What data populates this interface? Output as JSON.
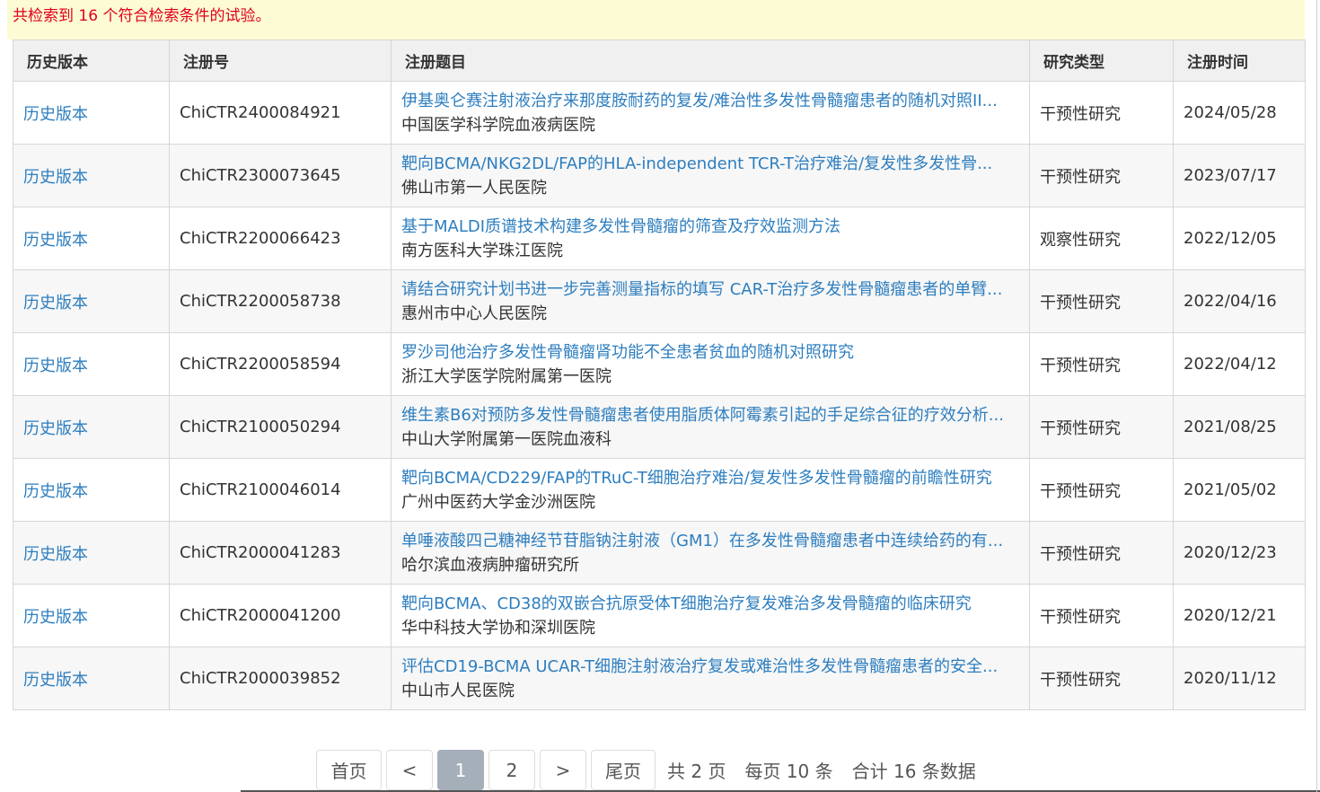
{
  "notice": {
    "text": "共检索到 16 个符合检索条件的试验。"
  },
  "results": {
    "columns": {
      "history": "历史版本",
      "reg_no": "注册号",
      "title": "注册题目",
      "study_type": "研究类型",
      "date": "注册时间"
    },
    "rows": [
      {
        "history": "历史版本",
        "reg_no": "ChiCTR2400084921",
        "title": "伊基奥仑赛注射液治疗来那度胺耐药的复发/难治性多发性骨髓瘤患者的随机对照II...",
        "institution": "中国医学科学院血液病医院",
        "study_type": "干预性研究",
        "date": "2024/05/28"
      },
      {
        "history": "历史版本",
        "reg_no": "ChiCTR2300073645",
        "title": "靶向BCMA/NKG2DL/FAP的HLA-independent TCR-T治疗难治/复发性多发性骨...",
        "institution": "佛山市第一人民医院",
        "study_type": "干预性研究",
        "date": "2023/07/17"
      },
      {
        "history": "历史版本",
        "reg_no": "ChiCTR2200066423",
        "title": "基于MALDI质谱技术构建多发性骨髓瘤的筛查及疗效监测方法",
        "institution": "南方医科大学珠江医院",
        "study_type": "观察性研究",
        "date": "2022/12/05"
      },
      {
        "history": "历史版本",
        "reg_no": "ChiCTR2200058738",
        "title": "请结合研究计划书进一步完善测量指标的填写 CAR-T治疗多发性骨髓瘤患者的单臂...",
        "institution": "惠州市中心人民医院",
        "study_type": "干预性研究",
        "date": "2022/04/16"
      },
      {
        "history": "历史版本",
        "reg_no": "ChiCTR2200058594",
        "title": "罗沙司他治疗多发性骨髓瘤肾功能不全患者贫血的随机对照研究",
        "institution": "浙江大学医学院附属第一医院",
        "study_type": "干预性研究",
        "date": "2022/04/12"
      },
      {
        "history": "历史版本",
        "reg_no": "ChiCTR2100050294",
        "title": "维生素B6对预防多发性骨髓瘤患者使用脂质体阿霉素引起的手足综合征的疗效分析...",
        "institution": "中山大学附属第一医院血液科",
        "study_type": "干预性研究",
        "date": "2021/08/25"
      },
      {
        "history": "历史版本",
        "reg_no": "ChiCTR2100046014",
        "title": "靶向BCMA/CD229/FAP的TRuC-T细胞治疗难治/复发性多发性骨髓瘤的前瞻性研究",
        "institution": "广州中医药大学金沙洲医院",
        "study_type": "干预性研究",
        "date": "2021/05/02"
      },
      {
        "history": "历史版本",
        "reg_no": "ChiCTR2000041283",
        "title": "单唾液酸四己糖神经节苷脂钠注射液（GM1）在多发性骨髓瘤患者中连续给药的有...",
        "institution": "哈尔滨血液病肿瘤研究所",
        "study_type": "干预性研究",
        "date": "2020/12/23"
      },
      {
        "history": "历史版本",
        "reg_no": "ChiCTR2000041200",
        "title": "靶向BCMA、CD38的双嵌合抗原受体T细胞治疗复发难治多发骨髓瘤的临床研究",
        "institution": "华中科技大学协和深圳医院",
        "study_type": "干预性研究",
        "date": "2020/12/21"
      },
      {
        "history": "历史版本",
        "reg_no": "ChiCTR2000039852",
        "title": "评估CD19-BCMA UCAR-T细胞注射液治疗复发或难治性多发性骨髓瘤患者的安全...",
        "institution": "中山市人民医院",
        "study_type": "干预性研究",
        "date": "2020/11/12"
      }
    ]
  },
  "pagination": {
    "first": "首页",
    "prev": "<",
    "pages": [
      "1",
      "2"
    ],
    "current": "1",
    "next": ">",
    "last": "尾页",
    "total_pages": "共 2 页",
    "per_page": "每页 10 条",
    "total_records": "合计 16 条数据"
  },
  "colors": {
    "link": "#2d7ebf",
    "notice_text": "#e0001b",
    "notice_bg": "#fdfbd3",
    "header_bg": "#f0f0f0",
    "active_page_bg": "#a5afba"
  }
}
